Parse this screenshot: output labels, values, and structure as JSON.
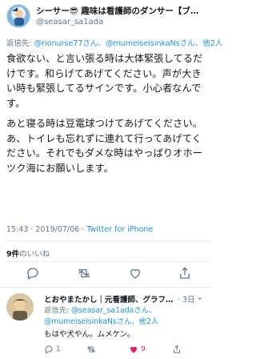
{
  "tweet": {
    "author_name": "シーサー😎 趣味は看護師のダンサー【ブ…",
    "author_handle": "@seasar_sa1ada",
    "reply_label": "返信先: ",
    "reply_mentions": "@rionurse77さん、@mumeiseisinkaNsさん、他2人",
    "paragraphs": [
      "食欲ない、と言い張る時は大体緊張してるだけです。和らげてあげてください。声が大きい時も緊張してるサインです。小心者なんです。",
      "あと寝る時は豆電球つけてあげてください。あ、トイレも忘れずに連れて行ってあげてください。それでもダメな時はやっぱりオホーツク海にお願いします。"
    ],
    "timestamp": "15:43 · 2019/07/06 · ",
    "source": "Twitter for iPhone",
    "likes_count": "9件",
    "likes_label": "のいいね",
    "icons": [
      "reply-icon",
      "retweet-icon",
      "like-icon",
      "share-icon"
    ],
    "accent_color": "#1b95e0",
    "like_color": "#e0245e"
  },
  "reply": {
    "author_name": "とおやまたかし｜元看護師、グラフ…",
    "time": "· 3日",
    "reply_label": "返信先: ",
    "mention_line1": "@seasar_sa1adaさん、",
    "mention_line2": "@mumeiseisinkaNsさん、他2人",
    "text": "もはや犬やん。ムメケン。",
    "reply_count": "1",
    "retweet_count": "",
    "like_count": "9"
  }
}
